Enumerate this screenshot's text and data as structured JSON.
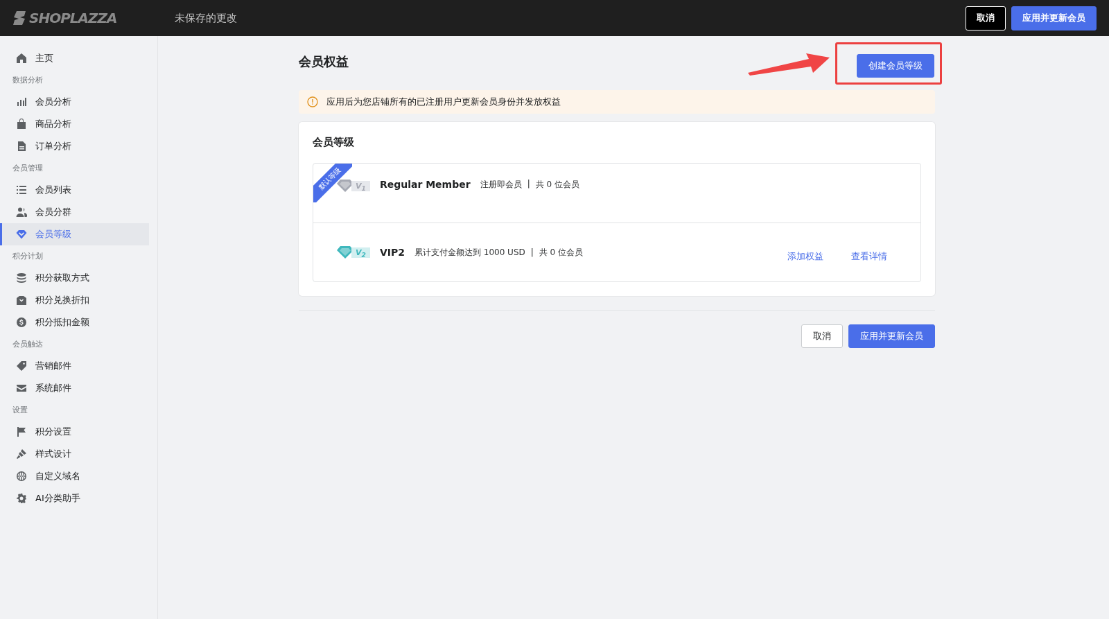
{
  "topbar": {
    "logo": "SHOPLAZZA",
    "status": "未保存的更改",
    "buttons": [
      {
        "label": "取消",
        "kind": "secondary"
      },
      {
        "label": "应用并更新会员",
        "kind": "primary"
      }
    ]
  },
  "sidebar": {
    "groups": [
      {
        "items": [
          {
            "label": "主页",
            "selected": false
          }
        ]
      },
      {
        "heading": "数据分析",
        "items": [
          {
            "label": "会员分析",
            "selected": false
          },
          {
            "label": "商品分析",
            "selected": false
          },
          {
            "label": "订单分析",
            "selected": false
          }
        ]
      },
      {
        "heading": "会员管理",
        "items": [
          {
            "label": "会员列表",
            "selected": false
          },
          {
            "label": "会员分群",
            "selected": false
          },
          {
            "label": "会员等级",
            "selected": true
          }
        ]
      },
      {
        "heading": "积分计划",
        "items": [
          {
            "label": "积分获取方式",
            "selected": false
          },
          {
            "label": "积分兑换折扣",
            "selected": false
          },
          {
            "label": "积分抵扣金额",
            "selected": false
          }
        ]
      },
      {
        "heading": "会员触达",
        "items": [
          {
            "label": "营销邮件",
            "selected": false
          },
          {
            "label": "系统邮件",
            "selected": false
          }
        ]
      },
      {
        "heading": "设置",
        "items": [
          {
            "label": "积分设置",
            "selected": false
          },
          {
            "label": "样式设计",
            "selected": false
          },
          {
            "label": "自定义域名",
            "selected": false
          },
          {
            "label": "AI分类助手",
            "selected": false
          }
        ]
      }
    ]
  },
  "page": {
    "title": "会员权益",
    "create_button": "创建会员等级",
    "notice": "应用后为您店铺所有的已注册用户更新会员身份并发放权益",
    "card": {
      "title": "会员等级",
      "levels": [
        {
          "ribbon": "默认等级",
          "badge": "V$_{1}$",
          "color": "#a6a9b3",
          "name": "Regular Member",
          "condition": "注册即会员",
          "separator": "|",
          "count": "共 0 位会员"
        },
        {
          "badge": "V$_{2}$",
          "color": "#3fb8bd",
          "name": "VIP2",
          "condition": "累计支付金额达到 1000 USD",
          "separator": "|",
          "count": "共 0 位会员",
          "actions": [
            "添加权益",
            "查看详情"
          ]
        }
      ]
    },
    "footer_buttons": [
      {
        "label": "取消",
        "kind": "secondary"
      },
      {
        "label": "应用并更新会员",
        "kind": "primary"
      }
    ]
  }
}
